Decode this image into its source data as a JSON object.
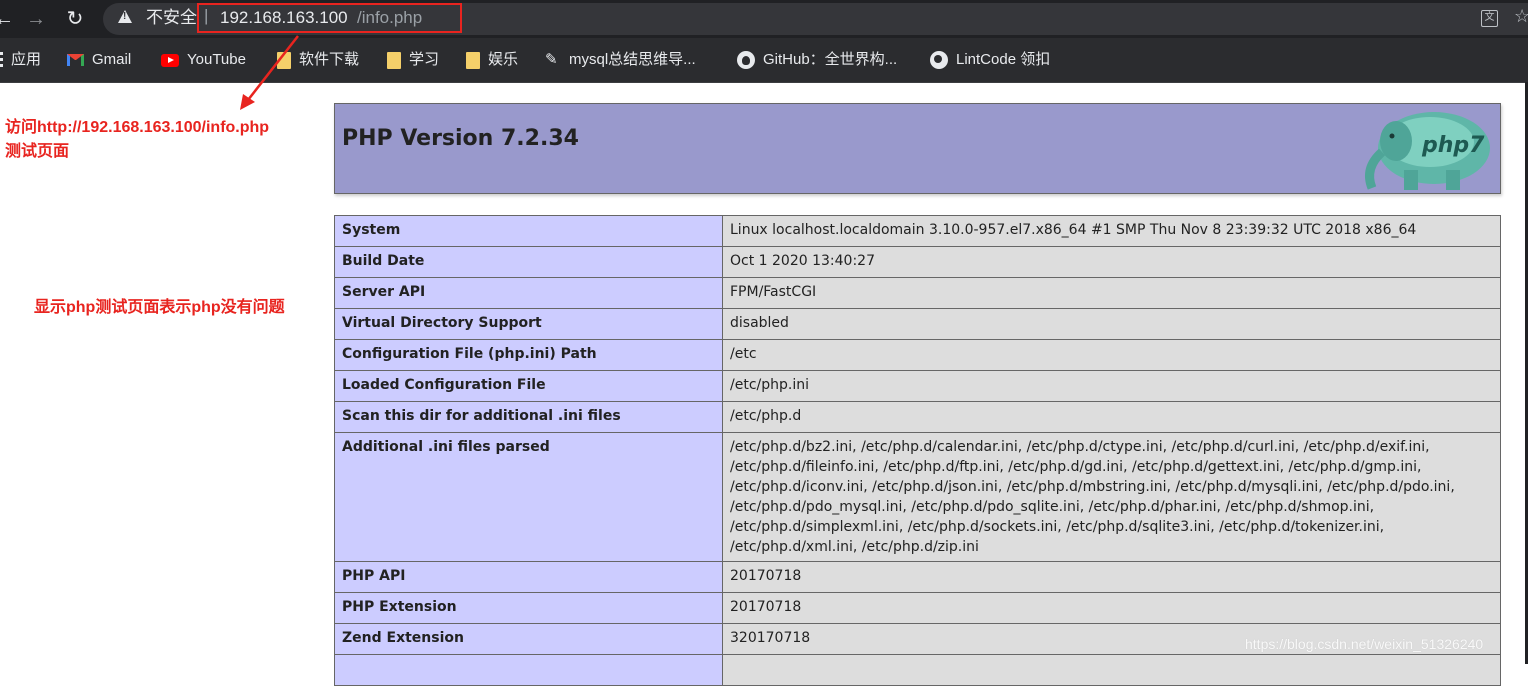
{
  "browser": {
    "security_label": "不安全",
    "separator": "|",
    "url_host": "192.168.163.100",
    "url_path": "/info.php"
  },
  "bookmarks": [
    {
      "label": "应用",
      "icon": "apps-icon"
    },
    {
      "label": "Gmail",
      "icon": "gmail-icon"
    },
    {
      "label": "YouTube",
      "icon": "youtube-icon"
    },
    {
      "label": "软件下载",
      "icon": "folder-icon"
    },
    {
      "label": "学习",
      "icon": "folder-icon"
    },
    {
      "label": "娱乐",
      "icon": "folder-icon"
    },
    {
      "label": "mysql总结思维导...",
      "icon": "edit-icon"
    },
    {
      "label": "GitHub：全世界构...",
      "icon": "github-icon"
    },
    {
      "label": "LintCode 领扣",
      "icon": "globe-icon"
    }
  ],
  "annotations": {
    "visit_line1": "访问http://192.168.163.100/info.php",
    "visit_line2": "测试页面",
    "result": "显示php测试页面表示php没有问题",
    "color": "#e8241f"
  },
  "php": {
    "title": "PHP Version 7.2.34",
    "logo_text": "php7",
    "rows": [
      {
        "key": "System",
        "value": "Linux localhost.localdomain 3.10.0-957.el7.x86_64 #1 SMP Thu Nov 8 23:39:32 UTC 2018 x86_64"
      },
      {
        "key": "Build Date",
        "value": "Oct 1 2020 13:40:27"
      },
      {
        "key": "Server API",
        "value": "FPM/FastCGI"
      },
      {
        "key": "Virtual Directory Support",
        "value": "disabled"
      },
      {
        "key": "Configuration File (php.ini) Path",
        "value": "/etc"
      },
      {
        "key": "Loaded Configuration File",
        "value": "/etc/php.ini"
      },
      {
        "key": "Scan this dir for additional .ini files",
        "value": "/etc/php.d"
      },
      {
        "key": "Additional .ini files parsed",
        "lines": [
          "/etc/php.d/bz2.ini, /etc/php.d/calendar.ini, /etc/php.d/ctype.ini, /etc/php.d/curl.ini, /etc/php.d/exif.ini,",
          "/etc/php.d/fileinfo.ini, /etc/php.d/ftp.ini, /etc/php.d/gd.ini, /etc/php.d/gettext.ini, /etc/php.d/gmp.ini,",
          "/etc/php.d/iconv.ini, /etc/php.d/json.ini, /etc/php.d/mbstring.ini, /etc/php.d/mysqli.ini, /etc/php.d/pdo.ini,",
          "/etc/php.d/pdo_mysql.ini, /etc/php.d/pdo_sqlite.ini, /etc/php.d/phar.ini, /etc/php.d/shmop.ini,",
          "/etc/php.d/simplexml.ini, /etc/php.d/sockets.ini, /etc/php.d/sqlite3.ini, /etc/php.d/tokenizer.ini,",
          "/etc/php.d/xml.ini, /etc/php.d/zip.ini"
        ]
      },
      {
        "key": "PHP API",
        "value": "20170718"
      },
      {
        "key": "PHP Extension",
        "value": "20170718"
      },
      {
        "key": "Zend Extension",
        "value": "320170718"
      },
      {
        "key": "",
        "value": ""
      }
    ]
  },
  "watermark": "https://blog.csdn.net/weixin_51326240"
}
